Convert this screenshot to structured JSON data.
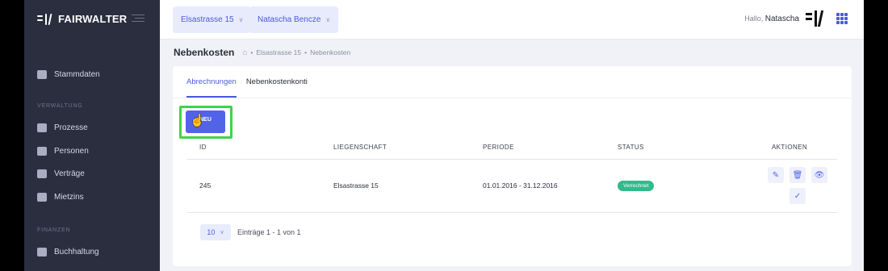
{
  "brand": {
    "name": "FAIRWALTER"
  },
  "sidebar": {
    "items": [
      {
        "label": "Stammdaten",
        "icon": "database-icon"
      },
      {
        "label": "Prozesse",
        "icon": "process-icon"
      },
      {
        "label": "Personen",
        "icon": "people-icon"
      },
      {
        "label": "Verträge",
        "icon": "contract-icon"
      },
      {
        "label": "Mietzins",
        "icon": "money-icon"
      },
      {
        "label": "Buchhaltung",
        "icon": "calculator-icon"
      }
    ],
    "sections": {
      "verwaltung": "VERWALTUNG",
      "finanzen": "FINANZEN"
    }
  },
  "topbar": {
    "property_select": "Elsastrasse 15",
    "user_select": "Natascha Bencze",
    "greeting": "Hallo,",
    "user_name": "Natascha"
  },
  "page": {
    "title": "Nebenkosten",
    "breadcrumb": [
      "Elsastrasse 15",
      "Nebenkosten"
    ],
    "breadcrumb_separator": "•"
  },
  "tabs": [
    {
      "label": "Abrechnungen",
      "active": true
    },
    {
      "label": "Nebenkostenkonti",
      "active": false
    }
  ],
  "new_button": {
    "label": "NEU"
  },
  "table": {
    "headers": [
      "ID",
      "LIEGENSCHAFT",
      "PERIODE",
      "STATUS",
      "AKTIONEN"
    ],
    "rows": [
      {
        "id": "245",
        "property": "Elsastrasse 15",
        "period": "01.01.2016 - 31.12.2016",
        "status": "Verrechnet"
      }
    ]
  },
  "pagination": {
    "page_size": "10",
    "info": "Einträge 1 - 1 von 1"
  },
  "colors": {
    "accent": "#4a5bd6",
    "sidebar": "#2a2e3f",
    "status_green": "#31bb8d",
    "highlight": "#3fd44a"
  }
}
